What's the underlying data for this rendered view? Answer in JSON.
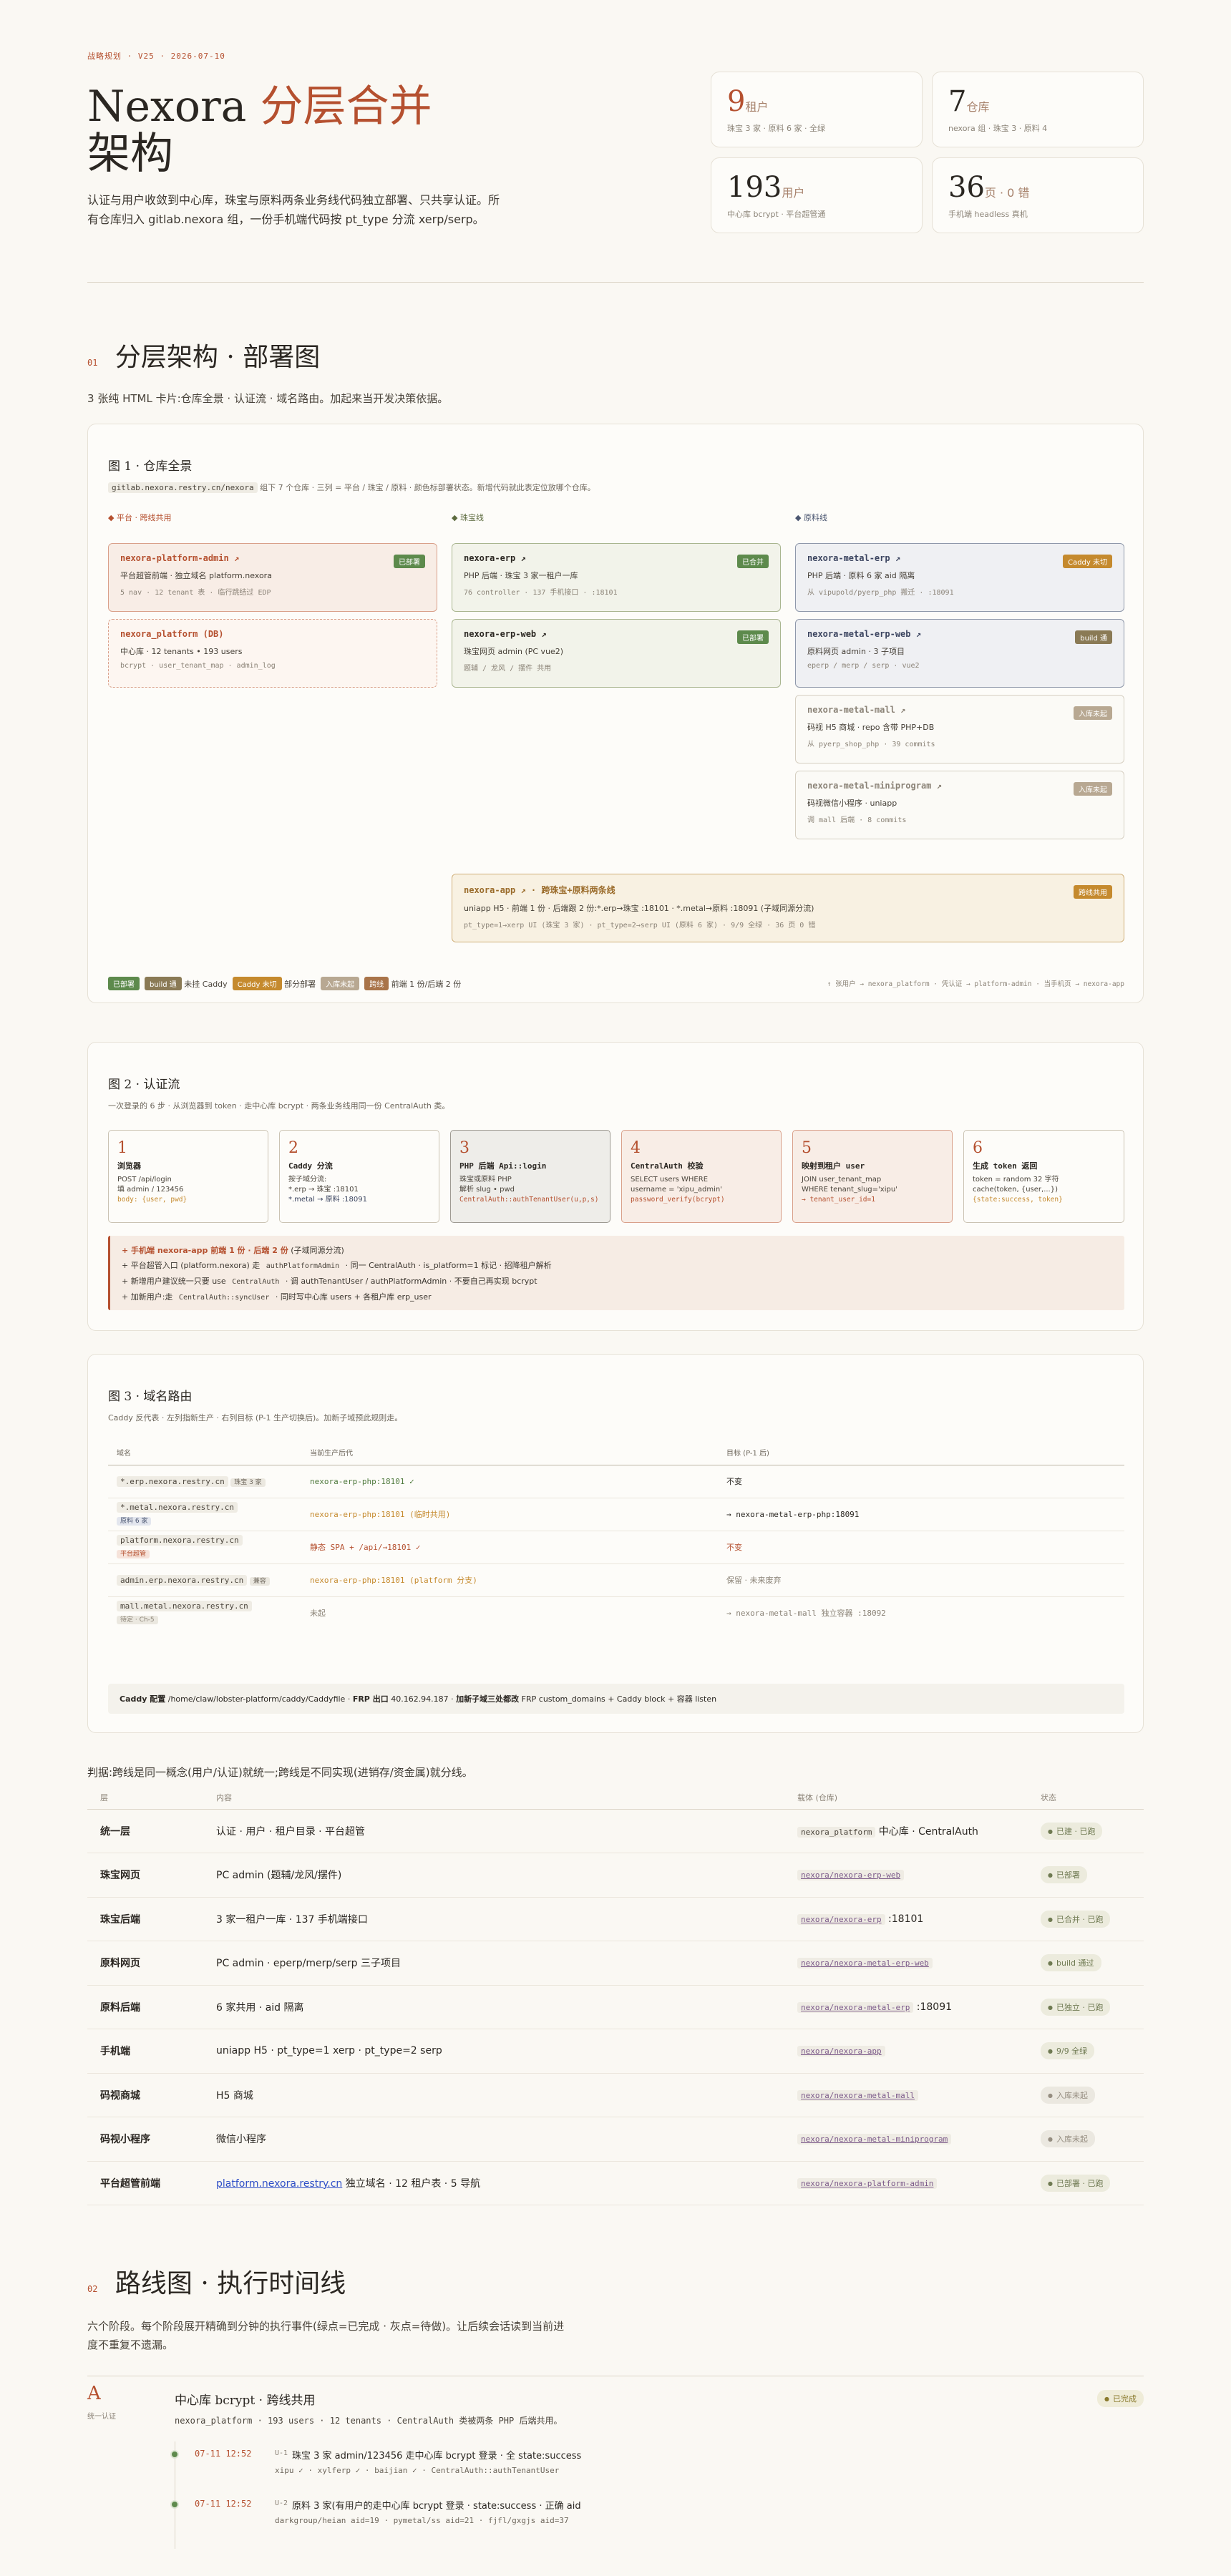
{
  "hero": {
    "kicker": "战略规划 · V25 · 2026-07-10",
    "title_a": "Nexora ",
    "title_b": "分层合并",
    "title_c": "架构",
    "lead": "认证与用户收敛到中心库，珠宝与原料两条业务线代码独立部署、只共享认证。所有仓库归入 gitlab.nexora 组，一份手机端代码按 pt_type 分流 xerp/serp。",
    "stats": [
      {
        "num": "9",
        "unit": "租户",
        "sub": "珠宝 3 家 · 原料 6 家 · 全绿"
      },
      {
        "num": "7",
        "unit": "仓库",
        "sub": "nexora 组 · 珠宝 3 · 原料 4"
      },
      {
        "num": "193",
        "unit": "用户",
        "sub": "中心库 bcrypt · 平台超管通"
      },
      {
        "num": "36",
        "unit": "页 · 0 错",
        "sub": "手机端 headless 真机"
      }
    ]
  },
  "s1": {
    "num": "01",
    "title": "分层架构 · 部署图",
    "desc": "3 张纯 HTML 卡片:仓库全景 · 认证流 · 域名路由。加起来当开发决策依据。"
  },
  "fig1": {
    "title": "图 1 · 仓库全景",
    "sub_code": "gitlab.nexora.restry.cn/nexora",
    "sub": " 组下 7 个仓库 · 三列 = 平台 / 珠宝 / 原料 · 颜色标部署状态。新增代码就此表定位放哪个仓库。",
    "cols": [
      "平台 · 跨线共用",
      "珠宝线",
      "原料线"
    ],
    "repos": {
      "platform_admin": {
        "t": "nexora-platform-admin ↗",
        "badge": "已部署",
        "d": "平台超管前端 · 独立域名 platform.nexora",
        "s": "5 nav · 12 tenant 表 · 临行跳结过 EDP"
      },
      "platform_db": {
        "t": "nexora_platform (DB)",
        "d": "中心库 · 12 tenants • 193 users",
        "s": "bcrypt · user_tenant_map · admin_log"
      },
      "erp": {
        "t": "nexora-erp ↗",
        "badge": "已合并",
        "d": "PHP 后端 · 珠宝 3 家一租户一库",
        "s": "76 controller · 137 手机接口 · :18101"
      },
      "erp_web": {
        "t": "nexora-erp-web ↗",
        "badge": "已部署",
        "d": "珠宝网页 admin (PC vue2)",
        "s": "题辅 / 龙风 / 摆件 共用"
      },
      "metal_erp": {
        "t": "nexora-metal-erp ↗",
        "badge": "Caddy 未切",
        "d": "PHP 后端 · 原料 6 家 aid 隔离",
        "s": "从 vipupold/pyerp_php 搬迁 · :18091"
      },
      "metal_erp_web": {
        "t": "nexora-metal-erp-web ↗",
        "badge": "build 通",
        "d": "原料网页 admin · 3 子项目",
        "s": "eperp / merp / serp · vue2"
      },
      "metal_mall": {
        "t": "nexora-metal-mall ↗",
        "badge": "入库未起",
        "d": "码视 H5 商城 · repo 含带 PHP+DB",
        "s": "从 pyerp_shop_php · 39 commits"
      },
      "metal_mini": {
        "t": "nexora-metal-miniprogram ↗",
        "badge": "入库未起",
        "d": "码视微信小程序 · uniapp",
        "s": "调 mall 后端 · 8 commits"
      },
      "app": {
        "t": "nexora-app ↗ · 跨珠宝+原料两条线",
        "badge": "跨线共用",
        "d": "uniapp H5 · 前端 1 份 · 后端跟 2 份:*.erp→珠宝 :18101 · *.metal→原料 :18091 (子域同源分流)",
        "s": "pt_type=1→xerp UI (珠宝 3 家) · pt_type=2→serp UI (原料 6 家) · 9/9 全绿 · 36 页 0 错"
      }
    },
    "legend": [
      {
        "badge": "已部署",
        "text": ""
      },
      {
        "badge": "build 通",
        "text": "未挂 Caddy"
      },
      {
        "badge": "Caddy 未切",
        "text": "部分部署"
      },
      {
        "badge": "入库未起",
        "text": ""
      },
      {
        "badge": "跨线",
        "text": "前端 1 份/后端 2 份"
      }
    ],
    "flow": "↑ 张用户 → nexora_platform · 凭认证 → platform-admin · 当手机页 → nexora-app"
  },
  "fig2": {
    "title": "图 2 · 认证流",
    "sub": "一次登录的 6 步 · 从浏览器到 token · 走中心库 bcrypt · 两条业务线用同一份 CentralAuth 类。",
    "steps": [
      {
        "n": "1",
        "h": "浏览器",
        "l1": "POST /api/login",
        "l2": "填 admin / 123456",
        "c1": "body: {user, pwd}",
        "c2": ""
      },
      {
        "n": "2",
        "h": "Caddy 分流",
        "l1": "按子域分流:",
        "l2": "*.erp → 珠宝 :18101",
        "c1": "",
        "c2": "",
        "l3": "*.metal → 原料 :18091"
      },
      {
        "n": "3",
        "h": "PHP 后端 Api::login",
        "l1": "珠宝或原料 PHP",
        "l2": "解析 slug • pwd",
        "c1": "CentralAuth::authTenantUser(u,p,s)",
        "c2": ""
      },
      {
        "n": "4",
        "h": "CentralAuth 校验",
        "l1": "SELECT users WHERE",
        "l2": "username = 'xipu_admin'",
        "c1": "password_verify(bcrypt)",
        "c2": ""
      },
      {
        "n": "5",
        "h": "映射到租户 user",
        "l1": "JOIN user_tenant_map",
        "l2": "WHERE tenant_slug='xipu'",
        "c1": "→ tenant_user_id=1",
        "c2": ""
      },
      {
        "n": "6",
        "h": "生成 token 返回",
        "l1": "token = random 32 字符",
        "l2": "cache(token, {user,...})",
        "c1": "{state:success, token}",
        "c2": ""
      }
    ],
    "notes": [
      {
        "lead": "+ 手机端 nexora-app 前端 1 份 · 后端 2 份",
        "rest": " (子域同源分流)"
      },
      {
        "lead": "+ 平台超管入口 (platform.nexora) 走 ",
        "code": "authPlatformAdmin",
        "rest": " · 同一 CentralAuth · is_platform=1 标记 · 招降租户解析"
      },
      {
        "lead": "+ 新增用户建议统一只要 use ",
        "code": "CentralAuth",
        "rest": " · 调 authTenantUser / authPlatformAdmin · 不要自己再实现 bcrypt"
      },
      {
        "lead": "+ 加新用户:走 ",
        "code": "CentralAuth::syncUser",
        "rest": " · 同时写中心库 users + 各租户库 erp_user"
      }
    ]
  },
  "fig3": {
    "title": "图 3 · 域名路由",
    "sub": "Caddy 反代表 · 左列指新生产 · 右列目标 (P-1 生产切换后)。加新子域预此规则走。",
    "headers": [
      "域名",
      "当前生产后代",
      "目标 (P-1 后)"
    ],
    "rows": [
      {
        "dom": "*.erp.nexora.restry.cn",
        "tag": "珠宝 3 家",
        "cur": "nexora-erp-php:18101 ✓",
        "cur_color": "#4f7a3d",
        "tgt": "不变",
        "tgt_color": "#2b2722"
      },
      {
        "dom": "*.metal.nexora.restry.cn",
        "tag": "原料 6 家",
        "cur": "nexora-erp-php:18101 (临时共用)",
        "cur_color": "#c58a2e",
        "tgt": "→ nexora-metal-erp-php:18091",
        "tgt_color": "#2b2722"
      },
      {
        "dom": "platform.nexora.restry.cn",
        "tag": "平台超管",
        "cur": "静态 SPA + /api/→18101 ✓",
        "cur_color": "#b5502f",
        "tgt": "不变",
        "tgt_color": "#b5502f"
      },
      {
        "dom": "admin.erp.nexora.restry.cn",
        "tag": "兼容",
        "cur": "nexora-erp-php:18101 (platform 分支)",
        "cur_color": "#c58a2e",
        "tgt": "保留 · 未来废弃",
        "tgt_color": "#8b8377"
      },
      {
        "dom": "mall.metal.nexora.restry.cn",
        "tag": "待定 · Ch-5",
        "cur": "未起",
        "cur_color": "#8b8377",
        "tgt": "→ nexora-metal-mall 独立容器 :18092",
        "tgt_color": "#8b8377"
      }
    ],
    "footer_a": "Caddy 配置",
    "footer_b": " /home/claw/lobster-platform/caddy/Caddyfile · ",
    "footer_c": "FRP 出口",
    "footer_d": " 40.162.94.187 · ",
    "footer_e": "加新子域三处都改",
    "footer_f": " FRP custom_domains + Caddy block + 容器 listen"
  },
  "summary": {
    "intro": "判据:跨线是同一概念(用户/认证)就统一;跨线是不同实现(进销存/资金属)就分线。",
    "headers": [
      "层",
      "内容",
      "载体 (仓库)",
      "状态"
    ],
    "rows": [
      {
        "layer": "统一层",
        "content": "认证 · 用户 · 租户目录 · 平台超管",
        "repo": "nexora_platform",
        "repo_link": false,
        "repo_rest": " 中心库 · CentralAuth",
        "status": "已建 · 已跑",
        "gray": false
      },
      {
        "layer": "珠宝网页",
        "content": "PC admin (题辅/龙风/摆件)",
        "repo": "nexora/nexora-erp-web",
        "repo_link": true,
        "repo_rest": "",
        "status": "已部署",
        "gray": false
      },
      {
        "layer": "珠宝后端",
        "content": "3 家一租户一库 · 137 手机端接口",
        "repo": "nexora/nexora-erp",
        "repo_link": true,
        "repo_rest": " :18101",
        "status": "已合并 · 已跑",
        "gray": false
      },
      {
        "layer": "原料网页",
        "content": "PC admin · eperp/merp/serp 三子项目",
        "repo": "nexora/nexora-metal-erp-web",
        "repo_link": true,
        "repo_rest": "",
        "status": "build 通过",
        "gray": false
      },
      {
        "layer": "原料后端",
        "content": "6 家共用 · aid 隔离",
        "repo": "nexora/nexora-metal-erp",
        "repo_link": true,
        "repo_rest": " :18091",
        "status": "已独立 · 已跑",
        "gray": false
      },
      {
        "layer": "手机端",
        "content": "uniapp H5 · pt_type=1 xerp · pt_type=2 serp",
        "repo": "nexora/nexora-app",
        "repo_link": true,
        "repo_rest": "",
        "status": "9/9 全绿",
        "gray": false
      },
      {
        "layer": "码视商城",
        "content": "H5 商城",
        "repo": "nexora/nexora-metal-mall",
        "repo_link": true,
        "repo_rest": "",
        "status": "入库未起",
        "gray": true
      },
      {
        "layer": "码视小程序",
        "content": "微信小程序",
        "repo": "nexora/nexora-metal-miniprogram",
        "repo_link": true,
        "repo_rest": "",
        "status": "入库未起",
        "gray": true
      },
      {
        "layer": "平台超管前端",
        "content_link": "platform.nexora.restry.cn",
        "content": " 独立域名 · 12 租户表 · 5 导航",
        "repo": "nexora/nexora-platform-admin",
        "repo_link": true,
        "repo_rest": "",
        "status": "已部署 · 已跑",
        "gray": false
      }
    ]
  },
  "s2": {
    "num": "02",
    "title": "路线图 · 执行时间线",
    "desc": "六个阶段。每个阶段展开精确到分钟的执行事件(绿点=已完成 · 灰点=待做)。让后续会话读到当前进度不重复不遗漏。"
  },
  "phaseA": {
    "letter": "A",
    "sub": "统一认证",
    "title": "中心库 bcrypt · 跨线共用",
    "desc": "nexora_platform · 193 users · 12 tenants · CentralAuth 类被两条 PHP 后端共用。",
    "status": "已完成",
    "events": [
      {
        "time": "07-11 12:52",
        "id": "U-1",
        "title": "珠宝 3 家 admin/123456 走中心库 bcrypt 登录 · 全 state:success",
        "meta": "xipu ✓ · xylferp ✓ · baijian ✓ · CentralAuth::authTenantUser"
      },
      {
        "time": "07-11 12:52",
        "id": "U-2",
        "title": "原料 3 家(有用户的走中心库 bcrypt 登录 · state:success · 正确 aid",
        "meta": "darkgroup/heian aid=19 · pymetal/ss aid=21 · fjfl/gxgjs aid=37"
      }
    ]
  }
}
